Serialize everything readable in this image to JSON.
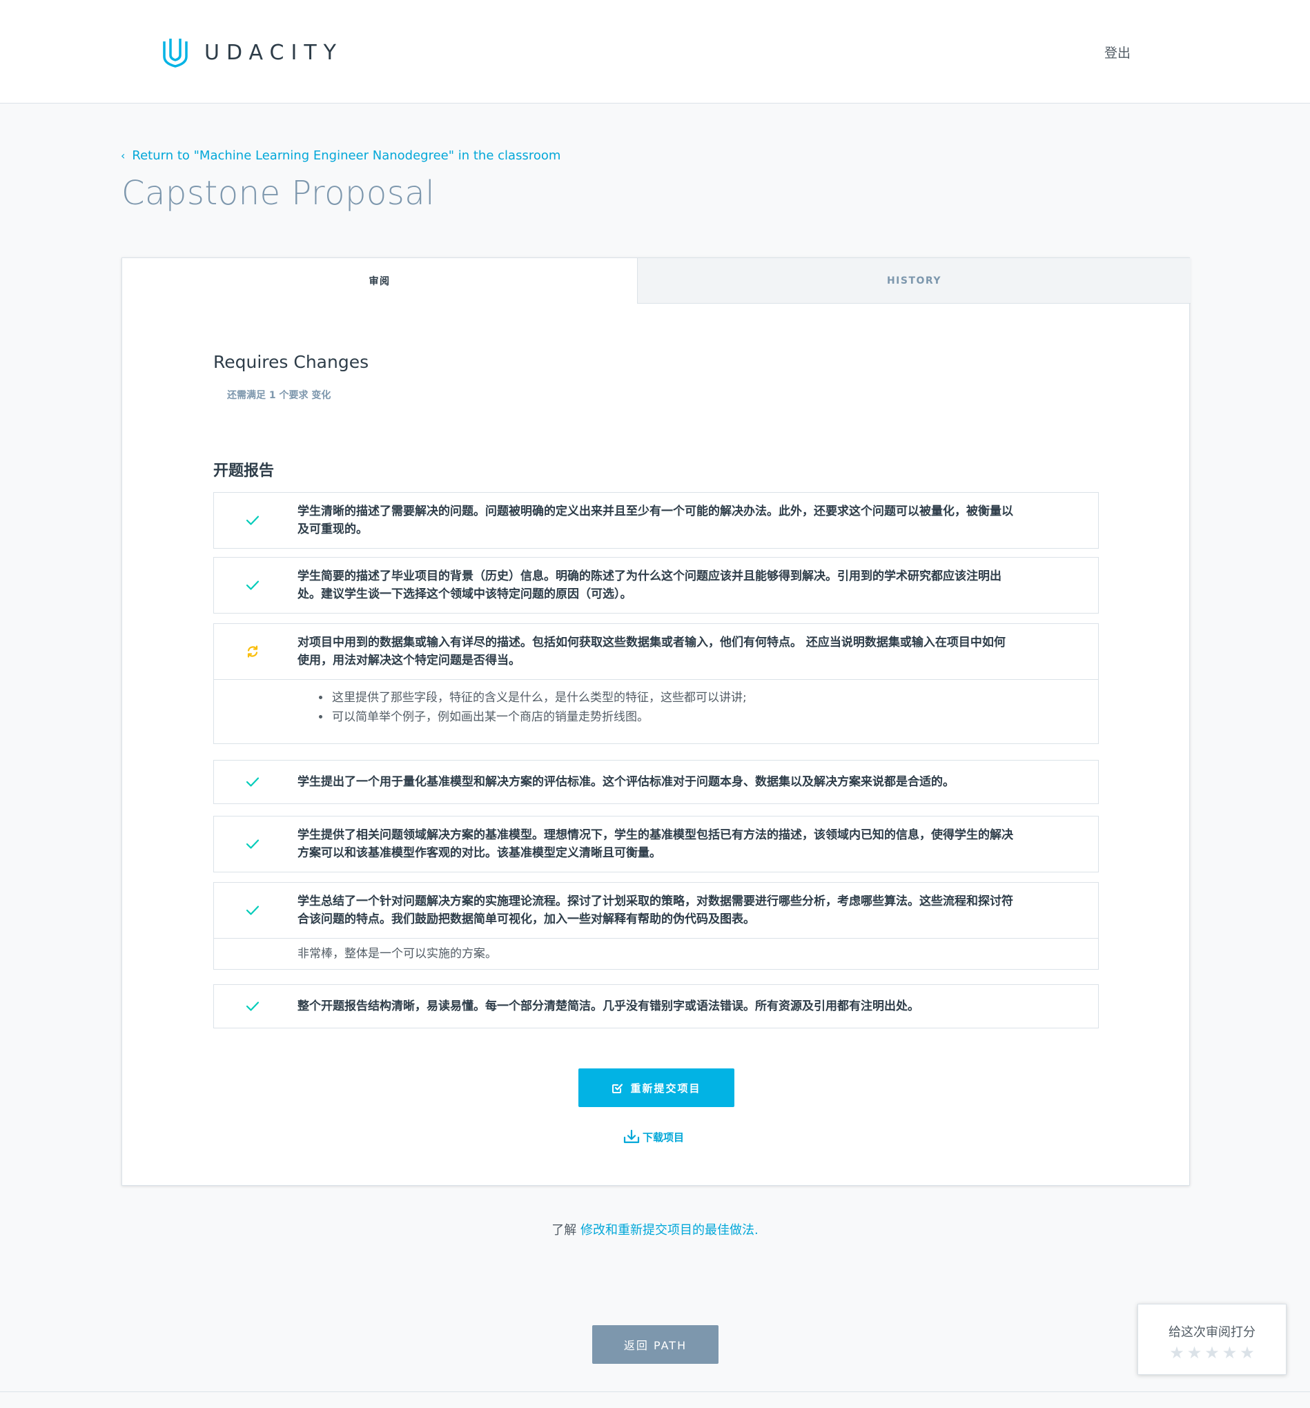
{
  "header": {
    "logo_text": "UDACITY",
    "logout_label": "登出"
  },
  "nav": {
    "back_link": "Return to \"Machine Learning Engineer Nanodegree\" in the classroom"
  },
  "page": {
    "title": "Capstone Proposal"
  },
  "tabs": [
    {
      "label": "审阅",
      "active": true
    },
    {
      "label": "HISTORY",
      "active": false
    }
  ],
  "review": {
    "status": "Requires Changes",
    "status_sub": "还需满足 1 个要求 变化",
    "section_title": "开题报告",
    "criteria": [
      {
        "status": "met",
        "text": "学生清晰的描述了需要解决的问题。问题被明确的定义出来并且至少有一个可能的解决办法。此外，还要求这个问题可以被量化，被衡量以及可重现的。"
      },
      {
        "status": "met",
        "text": "学生简要的描述了毕业项目的背景（历史）信息。明确的陈述了为什么这个问题应该并且能够得到解决。引用到的学术研究都应该注明出处。建议学生谈一下选择这个领域中该特定问题的原因（可选）。"
      },
      {
        "status": "requires-changes",
        "text": "对项目中用到的数据集或输入有详尽的描述。包括如何获取这些数据集或者输入，他们有何特点。 还应当说明数据集或输入在项目中如何使用，用法对解决这个特定问题是否得当。",
        "comments": [
          "这里提供了那些字段，特征的含义是什么，是什么类型的特征，这些都可以讲讲;",
          "可以简单举个例子，例如画出某一个商店的销量走势折线图。"
        ]
      },
      {
        "status": "met",
        "text": "学生提出了一个用于量化基准模型和解决方案的评估标准。这个评估标准对于问题本身、数据集以及解决方案来说都是合适的。"
      },
      {
        "status": "met",
        "text": "学生提供了相关问题领域解决方案的基准模型。理想情况下，学生的基准模型包括已有方法的描述，该领域内已知的信息，使得学生的解决方案可以和该基准模型作客观的对比。该基准模型定义清晰且可衡量。"
      },
      {
        "status": "met",
        "text": "学生总结了一个针对问题解决方案的实施理论流程。探讨了计划采取的策略，对数据需要进行哪些分析，考虑哪些算法。这些流程和探讨符合该问题的特点。我们鼓励把数据简单可视化，加入一些对解释有帮助的伪代码及图表。",
        "note": "非常棒，整体是一个可以实施的方案。"
      },
      {
        "status": "met",
        "text": "整个开题报告结构清晰，易读易懂。每一个部分清楚简洁。几乎没有错别字或语法错误。所有资源及引用都有注明出处。"
      }
    ],
    "resubmit_label": "重新提交项目",
    "download_label": "下载项目"
  },
  "footer": {
    "learn_prefix": "了解 ",
    "learn_link": "修改和重新提交项目的最佳做法.",
    "back_path_label": "返回 PATH"
  },
  "rating": {
    "title": "给这次审阅打分",
    "stars": 5
  },
  "colors": {
    "accent": "#02b3e4",
    "met": "#02ccba",
    "changes": "#f9bd0a",
    "title_gray": "#7d97ad"
  },
  "icons": {
    "met": "check-icon",
    "changes": "refresh-icon",
    "resubmit": "checkbox-icon",
    "download": "download-icon"
  }
}
